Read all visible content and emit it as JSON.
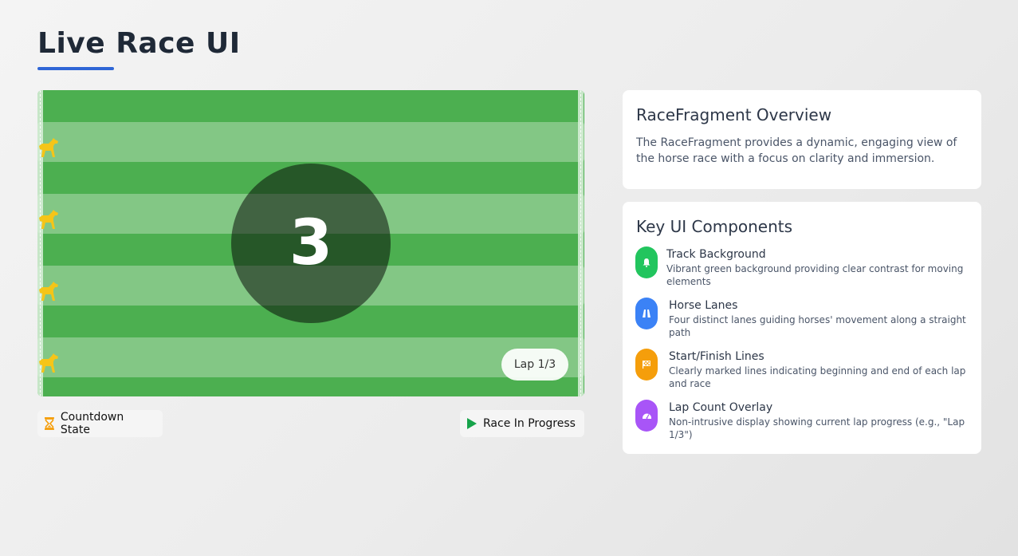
{
  "page": {
    "title": "Live Race UI"
  },
  "track": {
    "countdown": "3",
    "lap": "Lap 1/3",
    "track_color": "#4caf50",
    "lane_color": "#83c785",
    "horse_color": "#f5c518",
    "horse_icon": "horse-icon"
  },
  "states": {
    "countdown_label": "Countdown State",
    "countdown_icon": "hourglass-icon",
    "progress_label": "Race In Progress",
    "progress_icon": "play-icon"
  },
  "overview": {
    "title": "RaceFragment Overview",
    "description": "The RaceFragment provides a dynamic, engaging view of the horse race with a focus on clarity and immersion."
  },
  "components": {
    "title": "Key UI Components",
    "items": [
      {
        "name": "Track Background",
        "description": "Vibrant green background providing clear contrast for moving elements",
        "icon": "bell-icon",
        "color": "#22c55e"
      },
      {
        "name": "Horse Lanes",
        "description": "Four distinct lanes guiding horses' movement along a straight path",
        "icon": "road-icon",
        "color": "#3b82f6"
      },
      {
        "name": "Start/Finish Lines",
        "description": "Clearly marked lines indicating beginning and end of each lap and race",
        "icon": "checkered-flag-icon",
        "color": "#f59e0b"
      },
      {
        "name": "Lap Count Overlay",
        "description": "Non-intrusive display showing current lap progress (e.g., \"Lap 1/3\")",
        "icon": "gauge-icon",
        "color": "#a855f7"
      }
    ]
  }
}
